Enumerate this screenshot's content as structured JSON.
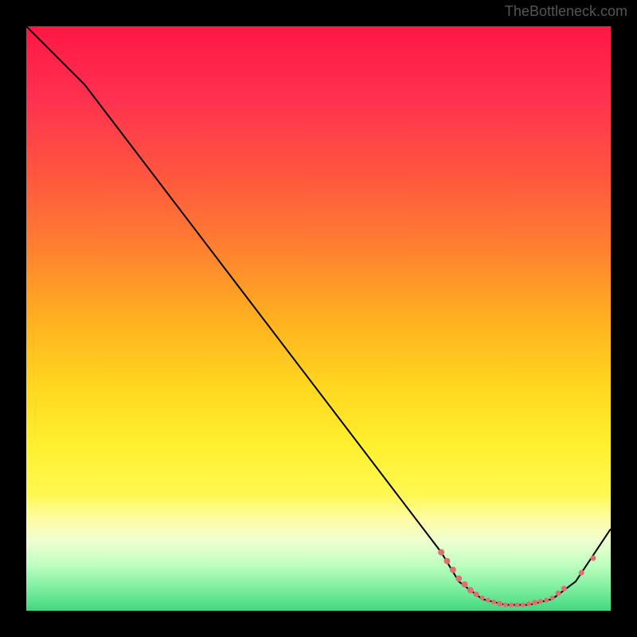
{
  "watermark": "TheBottleneck.com",
  "chart_data": {
    "type": "line",
    "title": "",
    "xlabel": "",
    "ylabel": "",
    "x_range": [
      0,
      100
    ],
    "y_range": [
      0,
      100
    ],
    "line_points": [
      {
        "x": 0,
        "y": 100
      },
      {
        "x": 6,
        "y": 94
      },
      {
        "x": 10,
        "y": 90
      },
      {
        "x": 71,
        "y": 10
      },
      {
        "x": 74,
        "y": 5
      },
      {
        "x": 78,
        "y": 2
      },
      {
        "x": 82,
        "y": 1
      },
      {
        "x": 86,
        "y": 1
      },
      {
        "x": 90,
        "y": 2
      },
      {
        "x": 94,
        "y": 5
      },
      {
        "x": 100,
        "y": 14
      }
    ],
    "highlight_points": [
      {
        "x": 71,
        "y": 10,
        "r": 4
      },
      {
        "x": 72,
        "y": 8.5,
        "r": 4
      },
      {
        "x": 73,
        "y": 7,
        "r": 4
      },
      {
        "x": 74,
        "y": 5.5,
        "r": 4
      },
      {
        "x": 75,
        "y": 4.5,
        "r": 4
      },
      {
        "x": 76,
        "y": 3.5,
        "r": 4
      },
      {
        "x": 77,
        "y": 2.8,
        "r": 3.5
      },
      {
        "x": 78,
        "y": 2.2,
        "r": 3
      },
      {
        "x": 79,
        "y": 1.8,
        "r": 3
      },
      {
        "x": 80,
        "y": 1.5,
        "r": 3
      },
      {
        "x": 81,
        "y": 1.2,
        "r": 3.5
      },
      {
        "x": 82,
        "y": 1,
        "r": 3
      },
      {
        "x": 83,
        "y": 1,
        "r": 3
      },
      {
        "x": 84,
        "y": 1,
        "r": 3
      },
      {
        "x": 85,
        "y": 1,
        "r": 3
      },
      {
        "x": 86,
        "y": 1.2,
        "r": 3
      },
      {
        "x": 87,
        "y": 1.4,
        "r": 3.5
      },
      {
        "x": 88,
        "y": 1.6,
        "r": 3
      },
      {
        "x": 89,
        "y": 1.8,
        "r": 3
      },
      {
        "x": 90,
        "y": 2.2,
        "r": 3
      },
      {
        "x": 91,
        "y": 3,
        "r": 3.5
      },
      {
        "x": 92,
        "y": 3.8,
        "r": 3.5
      },
      {
        "x": 95,
        "y": 6.5,
        "r": 3.5
      },
      {
        "x": 97,
        "y": 9,
        "r": 3.5
      }
    ],
    "gradient_stops": [
      {
        "offset": 0,
        "color": "#ff1744"
      },
      {
        "offset": 12,
        "color": "#ff3050"
      },
      {
        "offset": 25,
        "color": "#ff5540"
      },
      {
        "offset": 38,
        "color": "#ff8030"
      },
      {
        "offset": 50,
        "color": "#ffb020"
      },
      {
        "offset": 62,
        "color": "#ffd820"
      },
      {
        "offset": 72,
        "color": "#fff030"
      },
      {
        "offset": 80,
        "color": "#fff850"
      },
      {
        "offset": 84,
        "color": "#fffca0"
      },
      {
        "offset": 88,
        "color": "#f0ffd0"
      },
      {
        "offset": 92,
        "color": "#c0ffc0"
      },
      {
        "offset": 96,
        "color": "#80f0a0"
      },
      {
        "offset": 100,
        "color": "#40d880"
      }
    ]
  }
}
